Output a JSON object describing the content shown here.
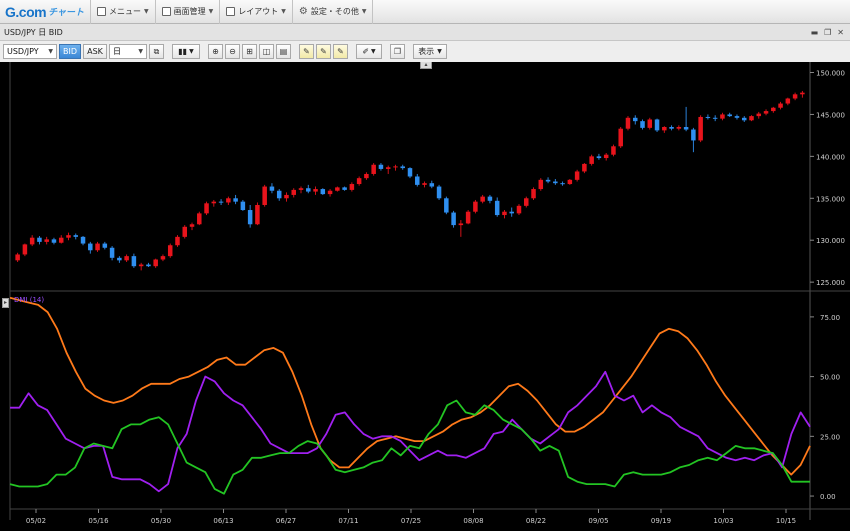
{
  "menubar": {
    "logo_main": "G.com",
    "logo_sub": "チャート",
    "items": [
      {
        "label": "メニュー",
        "icon": "list-icon"
      },
      {
        "label": "画面管理",
        "icon": "window-icon"
      },
      {
        "label": "レイアウト",
        "icon": "layout-icon"
      },
      {
        "label": "設定・その他",
        "icon": "gear-icon"
      }
    ]
  },
  "title_bar": {
    "title": "USD/JPY 日 BID"
  },
  "toolbar": {
    "symbol": "USD/JPY",
    "bid_label": "BID",
    "ask_label": "ASK",
    "period": "日",
    "display_label": "表示"
  },
  "chart_data": [
    {
      "type": "candlestick",
      "y_tick_labels": [
        "125.000",
        "130.000",
        "135.000",
        "140.000",
        "145.000",
        "150.000"
      ],
      "ylim": [
        124.3,
        150.3
      ],
      "x_tick_labels": [
        "05/02",
        "05/16",
        "05/30",
        "06/13",
        "06/27",
        "07/11",
        "07/25",
        "08/08",
        "08/22",
        "09/05",
        "09/19",
        "10/03",
        "10/15"
      ],
      "up_color": "#e8141c",
      "down_color": "#2f8ff0",
      "candles": [
        [
          127.6,
          128.5,
          127.4,
          128.3
        ],
        [
          128.3,
          129.6,
          128.1,
          129.5
        ],
        [
          129.5,
          130.6,
          129.3,
          130.3
        ],
        [
          130.3,
          130.5,
          129.5,
          129.8
        ],
        [
          129.8,
          130.4,
          129.5,
          130.1
        ],
        [
          130.1,
          130.3,
          129.5,
          129.7
        ],
        [
          129.7,
          130.6,
          129.6,
          130.3
        ],
        [
          130.3,
          130.9,
          130.0,
          130.6
        ],
        [
          130.6,
          130.8,
          130.1,
          130.4
        ],
        [
          130.4,
          130.5,
          129.4,
          129.6
        ],
        [
          129.6,
          129.8,
          128.4,
          128.8
        ],
        [
          128.8,
          129.8,
          128.6,
          129.6
        ],
        [
          129.6,
          129.8,
          128.9,
          129.1
        ],
        [
          129.1,
          129.3,
          127.6,
          127.9
        ],
        [
          127.9,
          128.1,
          127.3,
          127.6
        ],
        [
          127.6,
          128.3,
          127.4,
          128.1
        ],
        [
          128.1,
          128.4,
          126.7,
          126.9
        ],
        [
          126.9,
          127.3,
          126.4,
          127.1
        ],
        [
          127.1,
          127.3,
          126.8,
          126.9
        ],
        [
          126.9,
          127.8,
          126.7,
          127.7
        ],
        [
          127.7,
          128.3,
          127.5,
          128.1
        ],
        [
          128.1,
          129.6,
          127.9,
          129.4
        ],
        [
          129.4,
          130.6,
          129.2,
          130.4
        ],
        [
          130.4,
          131.8,
          130.2,
          131.6
        ],
        [
          131.6,
          132.1,
          131.2,
          131.9
        ],
        [
          131.9,
          133.4,
          131.8,
          133.2
        ],
        [
          133.2,
          134.6,
          133.0,
          134.4
        ],
        [
          134.4,
          134.8,
          134.0,
          134.6
        ],
        [
          134.6,
          134.9,
          134.2,
          134.5
        ],
        [
          134.5,
          135.2,
          134.2,
          135.0
        ],
        [
          135.0,
          135.4,
          134.3,
          134.6
        ],
        [
          134.6,
          134.8,
          133.5,
          133.6
        ],
        [
          133.6,
          134.2,
          131.5,
          131.9
        ],
        [
          131.9,
          134.5,
          131.8,
          134.2
        ],
        [
          134.2,
          136.6,
          134.0,
          136.4
        ],
        [
          136.4,
          136.8,
          135.6,
          135.9
        ],
        [
          135.9,
          136.1,
          134.7,
          135.0
        ],
        [
          135.0,
          135.7,
          134.6,
          135.4
        ],
        [
          135.4,
          136.2,
          135.1,
          136.0
        ],
        [
          136.0,
          136.4,
          135.6,
          136.2
        ],
        [
          136.2,
          136.6,
          135.6,
          135.8
        ],
        [
          135.8,
          136.4,
          135.4,
          136.1
        ],
        [
          136.1,
          136.2,
          135.4,
          135.5
        ],
        [
          135.5,
          136.1,
          135.2,
          135.9
        ],
        [
          135.9,
          136.4,
          135.8,
          136.3
        ],
        [
          136.3,
          136.4,
          135.9,
          136.0
        ],
        [
          136.0,
          136.9,
          135.8,
          136.7
        ],
        [
          136.7,
          137.6,
          136.5,
          137.4
        ],
        [
          137.4,
          138.1,
          137.2,
          137.9
        ],
        [
          137.9,
          139.2,
          137.7,
          139.0
        ],
        [
          139.0,
          139.2,
          138.3,
          138.5
        ],
        [
          138.5,
          138.9,
          137.9,
          138.7
        ],
        [
          138.7,
          139.0,
          138.3,
          138.8
        ],
        [
          138.8,
          139.0,
          138.4,
          138.6
        ],
        [
          138.6,
          138.7,
          137.4,
          137.6
        ],
        [
          137.6,
          137.9,
          136.4,
          136.6
        ],
        [
          136.6,
          137.0,
          136.3,
          136.8
        ],
        [
          136.8,
          137.1,
          136.2,
          136.4
        ],
        [
          136.4,
          136.6,
          134.8,
          135.0
        ],
        [
          135.0,
          135.2,
          133.1,
          133.3
        ],
        [
          133.3,
          133.5,
          131.5,
          131.8
        ],
        [
          131.8,
          132.4,
          130.4,
          132.0
        ],
        [
          132.0,
          133.6,
          131.9,
          133.4
        ],
        [
          133.4,
          134.8,
          133.2,
          134.6
        ],
        [
          134.6,
          135.4,
          134.4,
          135.2
        ],
        [
          135.2,
          135.4,
          134.4,
          134.7
        ],
        [
          134.7,
          135.1,
          132.8,
          133.0
        ],
        [
          133.0,
          133.6,
          132.6,
          133.4
        ],
        [
          133.4,
          133.9,
          132.8,
          133.2
        ],
        [
          133.2,
          134.3,
          133.0,
          134.1
        ],
        [
          134.1,
          135.2,
          133.9,
          135.0
        ],
        [
          135.0,
          136.3,
          134.8,
          136.1
        ],
        [
          136.1,
          137.4,
          135.9,
          137.2
        ],
        [
          137.2,
          137.5,
          136.8,
          137.0
        ],
        [
          137.0,
          137.3,
          136.6,
          136.8
        ],
        [
          136.8,
          137.0,
          136.5,
          136.7
        ],
        [
          136.7,
          137.3,
          136.6,
          137.2
        ],
        [
          137.2,
          138.4,
          137.0,
          138.2
        ],
        [
          138.2,
          139.2,
          138.0,
          139.1
        ],
        [
          139.1,
          140.2,
          138.9,
          140.0
        ],
        [
          140.0,
          140.3,
          139.6,
          139.8
        ],
        [
          139.8,
          140.4,
          139.5,
          140.2
        ],
        [
          140.2,
          141.4,
          140.0,
          141.2
        ],
        [
          141.2,
          143.5,
          141.0,
          143.3
        ],
        [
          143.3,
          144.8,
          143.1,
          144.6
        ],
        [
          144.6,
          144.9,
          143.8,
          144.2
        ],
        [
          144.2,
          144.4,
          143.2,
          143.4
        ],
        [
          143.4,
          144.6,
          143.2,
          144.4
        ],
        [
          144.4,
          144.5,
          142.9,
          143.1
        ],
        [
          143.1,
          143.6,
          142.8,
          143.5
        ],
        [
          143.5,
          143.7,
          143.1,
          143.3
        ],
        [
          143.3,
          143.7,
          143.1,
          143.5
        ],
        [
          143.5,
          145.9,
          143.0,
          143.2
        ],
        [
          143.2,
          143.4,
          140.5,
          141.9
        ],
        [
          141.9,
          144.9,
          141.7,
          144.7
        ],
        [
          144.7,
          145.0,
          144.4,
          144.6
        ],
        [
          144.6,
          144.9,
          144.2,
          144.5
        ],
        [
          144.5,
          145.2,
          144.3,
          145.0
        ],
        [
          145.0,
          145.2,
          144.7,
          144.8
        ],
        [
          144.8,
          145.0,
          144.4,
          144.6
        ],
        [
          144.6,
          144.8,
          144.1,
          144.3
        ],
        [
          144.3,
          144.9,
          144.2,
          144.8
        ],
        [
          144.8,
          145.3,
          144.5,
          145.1
        ],
        [
          145.1,
          145.6,
          144.9,
          145.4
        ],
        [
          145.4,
          145.9,
          145.2,
          145.8
        ],
        [
          145.8,
          146.5,
          145.6,
          146.3
        ],
        [
          146.3,
          147.0,
          146.1,
          146.9
        ],
        [
          146.9,
          147.6,
          146.7,
          147.4
        ],
        [
          147.4,
          147.8,
          147.0,
          147.6
        ]
      ]
    },
    {
      "type": "line",
      "indicator_label": "DMI (14)",
      "y_tick_labels": [
        "0.00",
        "25.00",
        "50.00",
        "75.00"
      ],
      "ylim": [
        -5,
        85
      ],
      "series": [
        {
          "color": "#ff7a1a",
          "values": [
            83,
            82,
            81,
            80,
            77,
            70,
            60,
            52,
            45,
            42,
            40,
            39,
            40,
            42,
            45,
            47,
            47,
            47,
            49,
            50,
            52,
            54,
            57,
            58,
            55,
            55,
            58,
            61,
            62,
            60,
            52,
            42,
            30,
            20,
            15,
            12,
            12,
            16,
            20,
            23,
            24,
            25,
            24,
            23,
            23,
            25,
            27,
            30,
            32,
            33,
            35,
            38,
            42,
            46,
            47,
            44,
            40,
            35,
            30,
            27,
            27,
            29,
            32,
            35,
            40,
            45,
            50,
            56,
            62,
            68,
            70,
            69,
            66,
            61,
            55,
            48,
            42,
            37,
            32,
            27,
            22,
            17,
            13,
            9,
            13,
            21
          ]
        },
        {
          "color": "#a020f0",
          "values": [
            37,
            37,
            43,
            38,
            36,
            30,
            24,
            22,
            20,
            21,
            21,
            8,
            7,
            7,
            7,
            5,
            2,
            5,
            20,
            26,
            40,
            50,
            48,
            43,
            40,
            38,
            33,
            28,
            22,
            20,
            18,
            18,
            18,
            20,
            26,
            34,
            35,
            30,
            26,
            24,
            25,
            25,
            23,
            19,
            15,
            17,
            19,
            17,
            17,
            16,
            18,
            20,
            26,
            27,
            32,
            28,
            24,
            22,
            25,
            28,
            35,
            38,
            42,
            46,
            52,
            42,
            40,
            42,
            35,
            38,
            35,
            33,
            29,
            27,
            25,
            20,
            18,
            16,
            15,
            16,
            15,
            17,
            18,
            12,
            26,
            35,
            29
          ]
        },
        {
          "color": "#23c423",
          "values": [
            5,
            4,
            4,
            4,
            5,
            9,
            9,
            12,
            20,
            22,
            21,
            20,
            28,
            30,
            30,
            32,
            33,
            30,
            22,
            14,
            12,
            10,
            3,
            1,
            9,
            11,
            16,
            16,
            17,
            18,
            18,
            21,
            23,
            22,
            17,
            11,
            10,
            11,
            12,
            14,
            15,
            20,
            17,
            21,
            20,
            26,
            30,
            38,
            40,
            35,
            34,
            38,
            36,
            32,
            30,
            28,
            24,
            19,
            21,
            19,
            8,
            6,
            5,
            5,
            5,
            4,
            9,
            10,
            9,
            9,
            9,
            10,
            12,
            13,
            15,
            16,
            15,
            18,
            21,
            20,
            20,
            19,
            18,
            13,
            6,
            6,
            6
          ]
        }
      ]
    }
  ]
}
